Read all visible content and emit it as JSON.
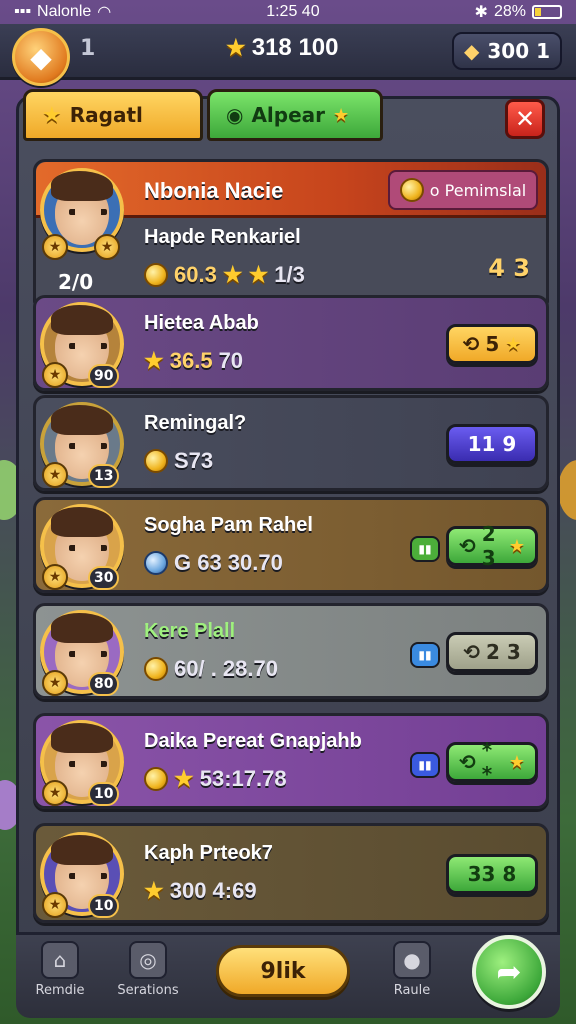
{
  "status_bar": {
    "carrier": "Nalonle",
    "time": "1:25 40",
    "battery": "28%",
    "battery_level": 0.28
  },
  "hud": {
    "level": "1",
    "coins": "318 100",
    "gems": "300 1"
  },
  "tabs": [
    {
      "label": "Ragatl"
    },
    {
      "label": "Alpear"
    }
  ],
  "header": {
    "title": "Nbonia Nacie",
    "chip_label": "o Pemimslal"
  },
  "rows": [
    {
      "name": "Hapde Renkariel",
      "stat": "60.3",
      "extra": "1/3",
      "counter": "2/0",
      "rank": "4 3"
    },
    {
      "name": "Hietea Abab",
      "stat": "36.5",
      "extra": "70",
      "badge": "90",
      "action": "5"
    },
    {
      "name": "Remingal?",
      "stat": "S73",
      "badge": "13",
      "action": "11 9"
    },
    {
      "name": "Sogha Pam Rahel",
      "stat": "G 63 30.70",
      "badge": "30",
      "action": "2 3"
    },
    {
      "name": "Kere Plall",
      "stat": "60/ . 28.70",
      "badge": "80",
      "action": "2 3"
    },
    {
      "name": "Daika Pereat Gnapjahb",
      "stat": "53:17.78",
      "badge": "10",
      "action": "* *"
    },
    {
      "name": "Kaph Prteok7",
      "stat": "300  4:69",
      "badge": "10",
      "action": "33 8"
    }
  ],
  "nav": [
    {
      "label": "Remdie"
    },
    {
      "label": "Serations"
    },
    {
      "label": "Raule"
    }
  ],
  "main_button": "9lik"
}
